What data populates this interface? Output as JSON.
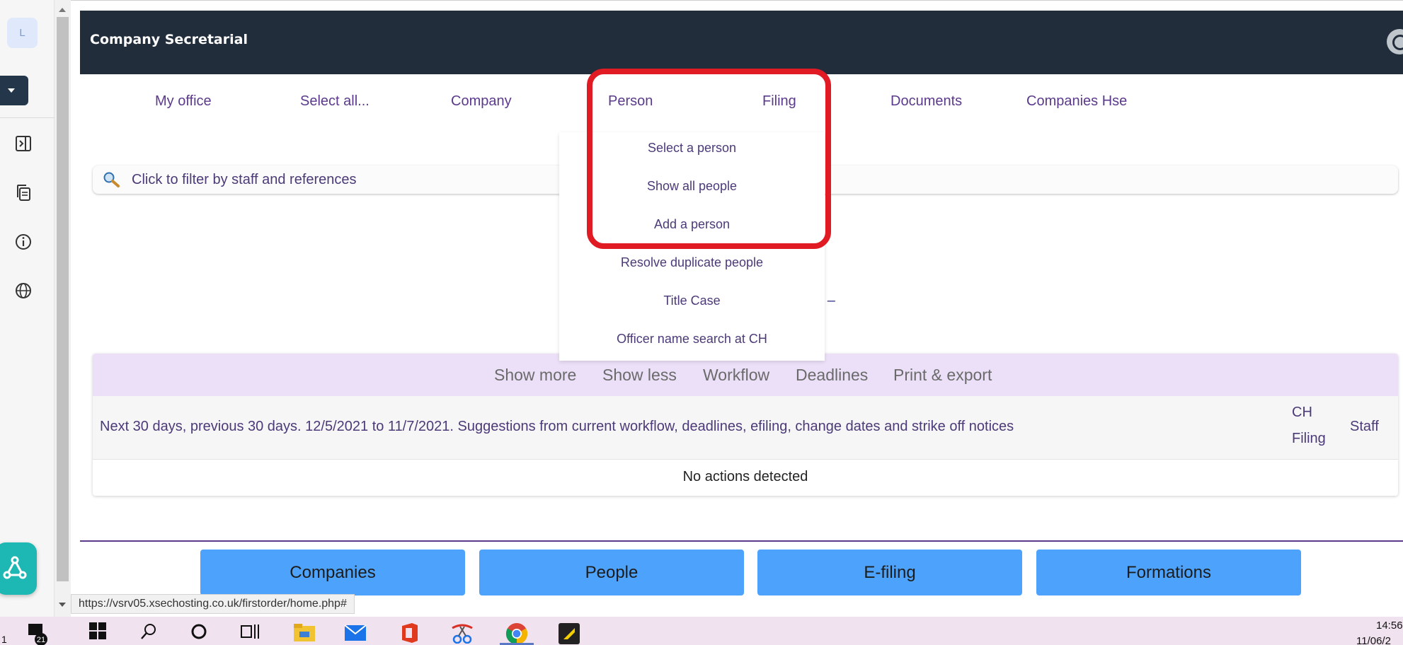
{
  "browser": {
    "profile_initial": "L",
    "status_url": "https://vsrv05.xsechosting.co.uk/firstorder/home.php#"
  },
  "header": {
    "title": "Company Secretarial"
  },
  "nav": {
    "items": [
      "My office",
      "Select all...",
      "Company",
      "Person",
      "Filing",
      "Documents",
      "Companies Hse"
    ]
  },
  "filter": {
    "placeholder": "Click to filter by staff and references"
  },
  "partial_text": "| –",
  "person_menu": {
    "items": [
      "Select a person",
      "Show all people",
      "Add a person",
      "Resolve duplicate people",
      "Title Case",
      "Officer name search at CH"
    ]
  },
  "actions": {
    "tabs": [
      "Show more",
      "Show less",
      "Workflow",
      "Deadlines",
      "Print & export"
    ],
    "header_text": "Next 30 days, previous 30 days. 12/5/2021 to 11/7/2021. Suggestions from current workflow, deadlines, efiling, change dates and strike off notices",
    "col_ch": "CH",
    "col_filing": "Filing",
    "col_staff": "Staff",
    "empty_message": "No actions detected"
  },
  "bottom_buttons": [
    "Companies",
    "People",
    "E-filing",
    "Formations"
  ],
  "taskbar": {
    "notification_count": "21",
    "left_number": "1",
    "time": "14:56",
    "date": "11/06/2"
  },
  "colors": {
    "header_bg": "#212d3a",
    "nav_text": "#5b3a8c",
    "highlight": "#e01b24",
    "tabs_bg": "#ece0f8",
    "button_bg": "#4da3fb"
  }
}
